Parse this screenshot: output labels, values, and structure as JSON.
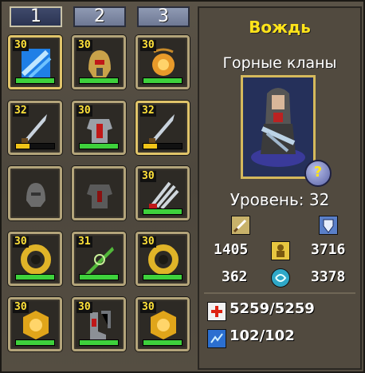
{
  "tabs": [
    "1",
    "2",
    "3"
  ],
  "slots": [
    {
      "level": "30",
      "bar": 1.0,
      "bar_color": "green",
      "icon": "crystal-icon",
      "gold": true
    },
    {
      "level": "30",
      "bar": 1.0,
      "bar_color": "green",
      "icon": "helmet-icon",
      "gold": false
    },
    {
      "level": "30",
      "bar": 1.0,
      "bar_color": "green",
      "icon": "amulet-icon",
      "gold": false
    },
    {
      "level": "32",
      "bar": 0.35,
      "bar_color": "yellow",
      "icon": "spear-icon",
      "gold": false
    },
    {
      "level": "30",
      "bar": 1.0,
      "bar_color": "green",
      "icon": "armor-icon",
      "gold": false
    },
    {
      "level": "32",
      "bar": 0.35,
      "bar_color": "yellow",
      "icon": "spear-icon",
      "gold": true
    },
    {
      "level": "",
      "bar": 0,
      "bar_color": "none",
      "icon": "helmet-empty-icon",
      "gold": false
    },
    {
      "level": "",
      "bar": 0,
      "bar_color": "none",
      "icon": "armor-empty-icon",
      "gold": false
    },
    {
      "level": "30",
      "bar": 1.0,
      "bar_color": "green",
      "icon": "claw-weapon-icon",
      "gold": false
    },
    {
      "level": "30",
      "bar": 1.0,
      "bar_color": "green",
      "icon": "ring-icon",
      "gold": false
    },
    {
      "level": "31",
      "bar": 1.0,
      "bar_color": "green",
      "icon": "green-blade-icon",
      "gold": false
    },
    {
      "level": "30",
      "bar": 1.0,
      "bar_color": "green",
      "icon": "ring-icon",
      "gold": false
    },
    {
      "level": "30",
      "bar": 1.0,
      "bar_color": "green",
      "icon": "amber-gem-icon",
      "gold": false
    },
    {
      "level": "30",
      "bar": 1.0,
      "bar_color": "green",
      "icon": "boots-icon",
      "gold": false
    },
    {
      "level": "30",
      "bar": 1.0,
      "bar_color": "green",
      "icon": "amber-gem-icon",
      "gold": false
    }
  ],
  "hero": {
    "title": "Вождь",
    "subtitle": "Горные кланы",
    "level": "Уровень: 32",
    "attack": "1405",
    "defense": "3716",
    "stat3": "362",
    "stat4": "3378",
    "hp": "5259/5259",
    "mana": "102/102"
  },
  "colors": {
    "title": "#ffe41a",
    "bar_green": "#3ed13c",
    "bar_yellow": "#f0c418",
    "slot_border": "#b3a47a"
  }
}
